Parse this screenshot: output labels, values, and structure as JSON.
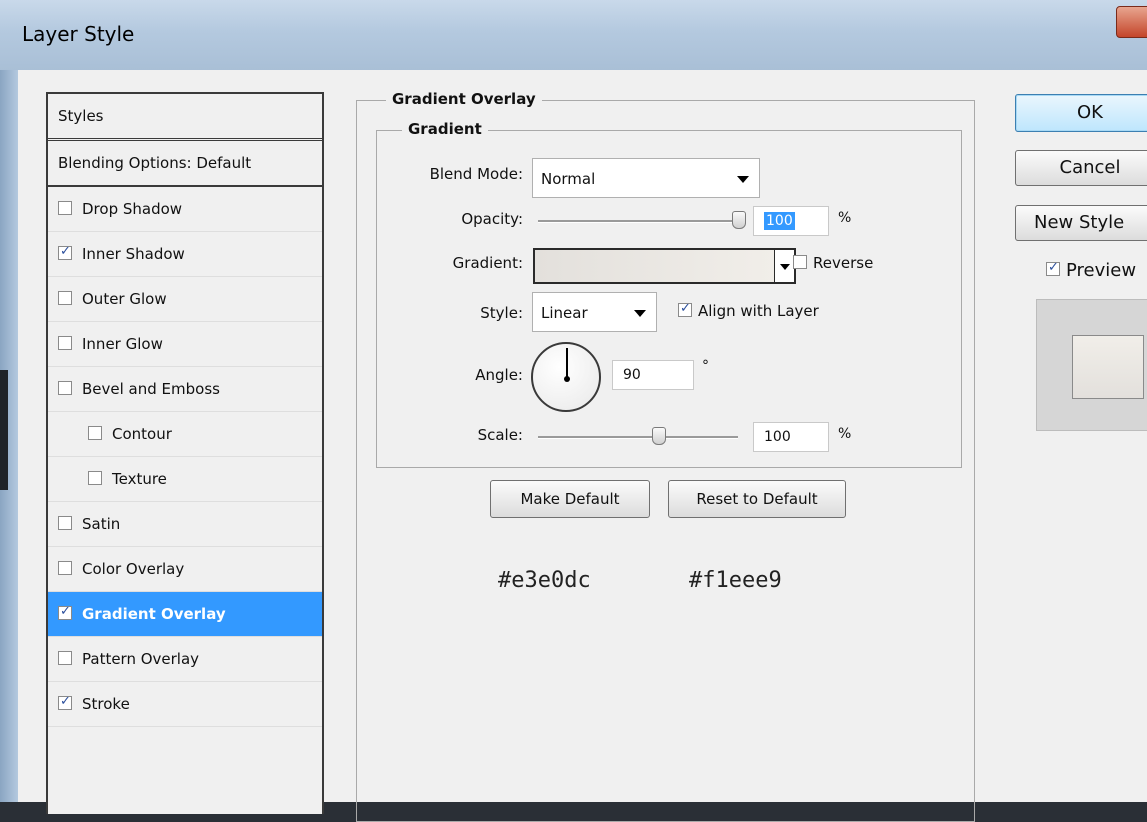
{
  "window": {
    "title": "Layer Style"
  },
  "styles_panel": {
    "header": "Styles",
    "blending_options": "Blending Options: Default",
    "items": [
      {
        "label": "Drop Shadow",
        "checked": false,
        "selected": false,
        "indent": false
      },
      {
        "label": "Inner Shadow",
        "checked": true,
        "selected": false,
        "indent": false
      },
      {
        "label": "Outer Glow",
        "checked": false,
        "selected": false,
        "indent": false
      },
      {
        "label": "Inner Glow",
        "checked": false,
        "selected": false,
        "indent": false
      },
      {
        "label": "Bevel and Emboss",
        "checked": false,
        "selected": false,
        "indent": false
      },
      {
        "label": "Contour",
        "checked": false,
        "selected": false,
        "indent": true
      },
      {
        "label": "Texture",
        "checked": false,
        "selected": false,
        "indent": true
      },
      {
        "label": "Satin",
        "checked": false,
        "selected": false,
        "indent": false
      },
      {
        "label": "Color Overlay",
        "checked": false,
        "selected": false,
        "indent": false
      },
      {
        "label": "Gradient Overlay",
        "checked": true,
        "selected": true,
        "indent": false
      },
      {
        "label": "Pattern Overlay",
        "checked": false,
        "selected": false,
        "indent": false
      },
      {
        "label": "Stroke",
        "checked": true,
        "selected": false,
        "indent": false
      }
    ]
  },
  "gradient_overlay": {
    "group_title": "Gradient Overlay",
    "subgroup_title": "Gradient",
    "blend_mode": {
      "label": "Blend Mode:",
      "value": "Normal"
    },
    "opacity": {
      "label": "Opacity:",
      "value": "100",
      "unit": "%",
      "fraction": 1.0
    },
    "gradient": {
      "label": "Gradient:",
      "colors": [
        "#e3e0dc",
        "#f1eee9"
      ]
    },
    "reverse": {
      "label": "Reverse",
      "checked": false
    },
    "style": {
      "label": "Style:",
      "value": "Linear"
    },
    "align_with_layer": {
      "label": "Align with Layer",
      "checked": true
    },
    "angle": {
      "label": "Angle:",
      "value": "90",
      "unit": "°"
    },
    "scale": {
      "label": "Scale:",
      "value": "100",
      "unit": "%",
      "fraction": 0.6
    },
    "make_default": "Make Default",
    "reset_to_default": "Reset to Default",
    "hex_start": "#e3e0dc",
    "hex_end": "#f1eee9"
  },
  "right_panel": {
    "ok": "OK",
    "cancel": "Cancel",
    "new_style": "New Style",
    "preview": {
      "label": "Preview",
      "checked": true
    }
  },
  "colors": {
    "selection": "#3399ff",
    "close_button": "#c4452a"
  }
}
